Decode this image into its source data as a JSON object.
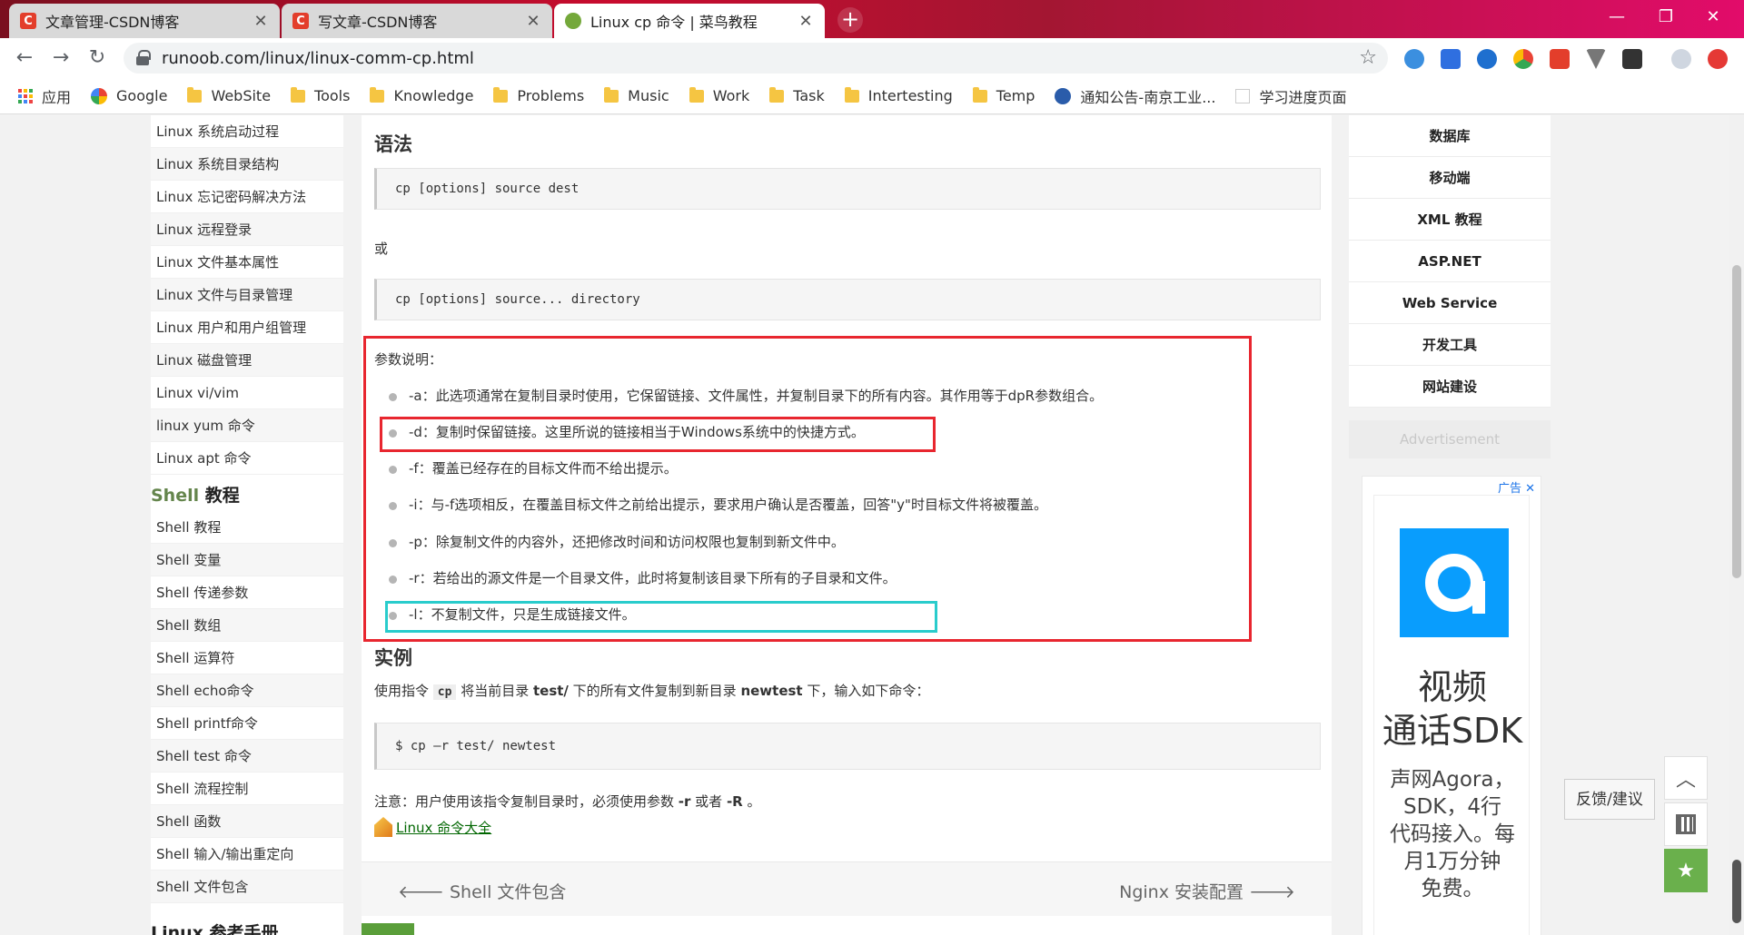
{
  "browser": {
    "tabs": [
      {
        "title": "文章管理-CSDN博客",
        "icon": "csdn-icon",
        "active": false
      },
      {
        "title": "写文章-CSDN博客",
        "icon": "csdn-icon",
        "active": false
      },
      {
        "title": "Linux cp 命令 | 菜鸟教程",
        "icon": "runoob-icon",
        "active": true
      }
    ],
    "new_tab_glyph": "+",
    "url": "runoob.com/linux/linux-comm-cp.html",
    "bookmarks": [
      {
        "label": "应用",
        "icon": "apps-grid-icon"
      },
      {
        "label": "Google",
        "icon": "google-icon"
      },
      {
        "label": "WebSite",
        "icon": "folder-icon"
      },
      {
        "label": "Tools",
        "icon": "folder-icon"
      },
      {
        "label": "Knowledge",
        "icon": "folder-icon"
      },
      {
        "label": "Problems",
        "icon": "folder-icon"
      },
      {
        "label": "Music",
        "icon": "folder-icon"
      },
      {
        "label": "Work",
        "icon": "folder-icon"
      },
      {
        "label": "Task",
        "icon": "folder-icon"
      },
      {
        "label": "Intertesting",
        "icon": "folder-icon"
      },
      {
        "label": "Temp",
        "icon": "folder-icon"
      },
      {
        "label": "通知公告-南京工业...",
        "icon": "school-icon"
      },
      {
        "label": "学习进度页面",
        "icon": "page-icon"
      }
    ]
  },
  "leftnav": {
    "linux_items": [
      "Linux 系统启动过程",
      "Linux 系统目录结构",
      "Linux 忘记密码解决方法",
      "Linux 远程登录",
      "Linux 文件基本属性",
      "Linux 文件与目录管理",
      "Linux 用户和用户组管理",
      "Linux 磁盘管理",
      "Linux vi/vim",
      "linux yum 命令",
      "Linux apt 命令"
    ],
    "shell_heading_green": "Shell",
    "shell_heading_rest": " 教程",
    "shell_items": [
      "Shell 教程",
      "Shell 变量",
      "Shell 传递参数",
      "Shell 数组",
      "Shell 运算符",
      "Shell echo命令",
      "Shell printf命令",
      "Shell test 命令",
      "Shell 流程控制",
      "Shell 函数",
      "Shell 输入/输出重定向",
      "Shell 文件包含"
    ],
    "next_heading": "Linux 参考手册"
  },
  "content": {
    "syntax_heading": "语法",
    "syntax_code_1": "cp [options] source dest",
    "or_text": "或",
    "syntax_code_2": "cp [options] source... directory",
    "params_label": "参数说明：",
    "params": [
      "-a：此选项通常在复制目录时使用，它保留链接、文件属性，并复制目录下的所有内容。其作用等于dpR参数组合。",
      "-d：复制时保留链接。这里所说的链接相当于Windows系统中的快捷方式。",
      "-f：覆盖已经存在的目标文件而不给出提示。",
      "-i：与-f选项相反，在覆盖目标文件之前给出提示，要求用户确认是否覆盖，回答\"y\"时目标文件将被覆盖。",
      "-p：除复制文件的内容外，还把修改时间和访问权限也复制到新文件中。",
      "-r：若给出的源文件是一个目录文件，此时将复制该目录下所有的子目录和文件。",
      "-l：不复制文件，只是生成链接文件。"
    ],
    "example_heading": "实例",
    "example_pre": "使用指令 ",
    "example_cmd": "cp",
    "example_mid1": " 将当前目录 ",
    "example_src": "test/",
    "example_mid2": " 下的所有文件复制到新目录 ",
    "example_dst": "newtest",
    "example_post": " 下，输入如下命令：",
    "example_code": "$ cp –r test/ newtest",
    "note_pre": "注意：用户使用该指令复制目录时，必须使用参数 ",
    "note_a": "-r",
    "note_mid": " 或者 ",
    "note_b": "-R",
    "note_post": " 。",
    "link_all": "Linux 命令大全",
    "prev_label": "Shell 文件包含",
    "next_label": "Nginx 安装配置"
  },
  "rightcol": {
    "menu": [
      "数据库",
      "移动端",
      "XML 教程",
      "ASP.NET",
      "Web Service",
      "开发工具",
      "网站建设"
    ],
    "advertisement": "Advertisement",
    "ad_tag": "广告",
    "ad_title_1": "视频",
    "ad_title_2": "通话SDK",
    "ad_body": [
      "声网Agora，",
      "SDK，4行",
      "代码接入。每",
      "月1万分钟",
      "免费。"
    ]
  },
  "feedback": "反馈/建议",
  "colors": {
    "highlight_red": "#e8262f",
    "highlight_cyan": "#29cccc",
    "brand_green": "#64854c",
    "ad_blue": "#099dfd"
  }
}
